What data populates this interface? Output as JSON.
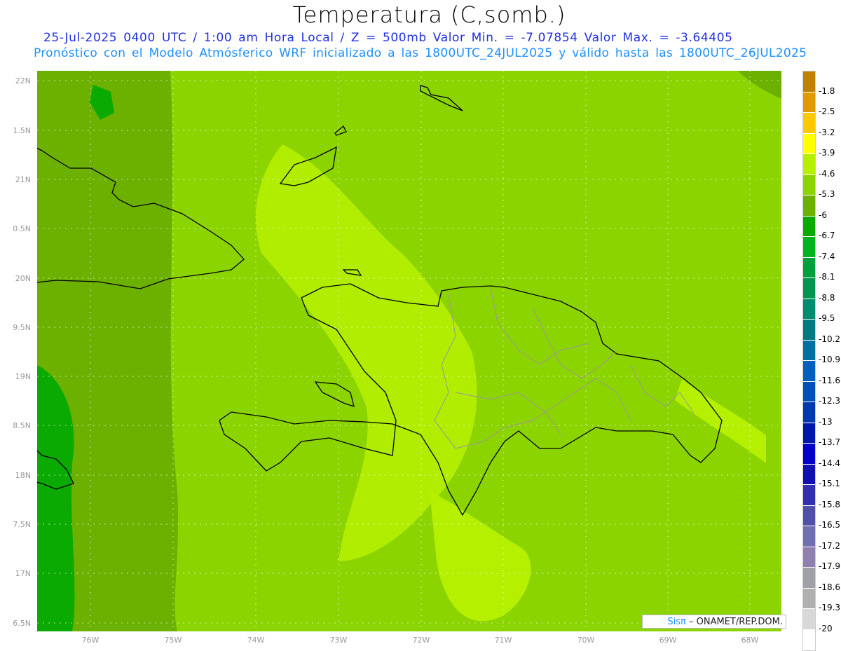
{
  "header": {
    "title": "Temperatura (C,somb.)",
    "line1": "25-Jul-2025  0400 UTC / 1:00 am Hora Local / Z = 500mb  Valor Min. = -7.07854  Valor Max. = -3.64405",
    "line2": "Pronóstico con el Modelo Atmósferico WRF inicializado a las 1800UTC_24JUL2025 y válido hasta las  1800UTC_26JUL2025"
  },
  "axes": {
    "lat_labels": [
      "22N",
      "1.5N",
      "21N",
      "0.5N",
      "20N",
      "9.5N",
      "19N",
      "8.5N",
      "18N",
      "7.5N",
      "17N",
      "6.5N"
    ],
    "lon_labels": [
      "76W",
      "75W",
      "74W",
      "73W",
      "72W",
      "71W",
      "70W",
      "69W",
      "68W"
    ]
  },
  "colorbar": {
    "labels": [
      "-1.8",
      "-2.5",
      "-3.2",
      "-3.9",
      "-4.6",
      "-5.3",
      "-6",
      "-6.7",
      "-7.4",
      "-8.1",
      "-8.8",
      "-9.5",
      "-10.2",
      "-10.9",
      "-11.6",
      "-12.3",
      "-13",
      "-13.7",
      "-14.4",
      "-15.1",
      "-15.8",
      "-16.5",
      "-17.2",
      "-17.9",
      "-18.6",
      "-19.3",
      "-20"
    ],
    "colors": [
      "#c08000",
      "#e09a00",
      "#ffc800",
      "#ffff00",
      "#b4f000",
      "#8cd400",
      "#6cb000",
      "#0aaa00",
      "#00b41e",
      "#00a03c",
      "#009650",
      "#008c6e",
      "#007c80",
      "#00709e",
      "#0060c0",
      "#0050b8",
      "#0038b0",
      "#0018aa",
      "#0000c8",
      "#1010b0",
      "#3030b0",
      "#5050a8",
      "#7070b0",
      "#9080b0",
      "#a0a0a8",
      "#b0b0b0",
      "#d8d8d8",
      "#ffffff"
    ]
  },
  "footer": {
    "logo_sis": "Sisπ",
    "logo_text": " – ONAMET/REP.DOM."
  }
}
